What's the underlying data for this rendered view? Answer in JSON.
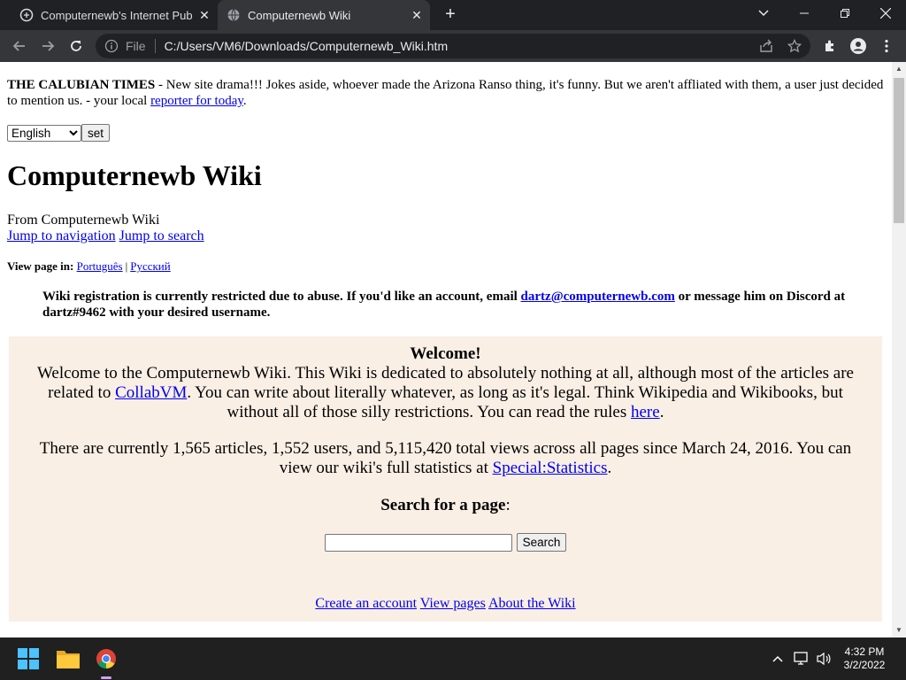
{
  "browser": {
    "tabs": [
      {
        "title": "Computernewb's Internet Pub Hub",
        "active": false
      },
      {
        "title": "Computernewb Wiki",
        "active": true
      }
    ],
    "address": {
      "scheme_label": "File",
      "url": "C:/Users/VM6/Downloads/Computernewb_Wiki.htm"
    }
  },
  "page": {
    "news": {
      "prefix": "THE CALUBIAN TIMES",
      "text": " - New site drama!!! Jokes aside, whoever made the Arizona Ranso thing, it's funny. But we aren't affliated with them, a user just decided to mention us. - your local ",
      "link": "reporter for today",
      "suffix": "."
    },
    "language": {
      "selected": "English",
      "set_label": "set"
    },
    "title": "Computernewb Wiki",
    "from": "From Computernewb Wiki",
    "jump_nav": "Jump to navigation",
    "jump_search": "Jump to search",
    "view_in_label": "View page in:",
    "view_in_langs": [
      "Português",
      "Русский"
    ],
    "notice": {
      "text1": "Wiki registration is currently restricted due to abuse. If you'd like an account, email ",
      "email": "dartz@computernewb.com",
      "text2": " or message him on Discord at dartz#9462 with your desired username."
    },
    "welcome": {
      "title": "Welcome!",
      "p1_a": "Welcome to the Computernewb Wiki. This Wiki is dedicated to absolutely nothing at all, although most of the articles are related to ",
      "p1_link": "CollabVM",
      "p1_b": ". You can write about literally whatever, as long as it's legal. Think Wikipedia and Wikibooks, but without all of those silly restrictions. You can read the rules ",
      "p1_link2": "here",
      "p1_c": ".",
      "p2_a": "There are currently 1,565 articles, 1,552 users, and 5,115,420 total views across all pages since March 24, 2016. You can view our wiki's full statistics at ",
      "p2_link": "Special:Statistics",
      "p2_b": ".",
      "search_title": "Search for a page",
      "search_colon": ":",
      "search_button": "Search",
      "links": [
        "Create an account",
        "View pages",
        "About the Wiki"
      ]
    }
  },
  "taskbar": {
    "time": "4:32 PM",
    "date": "3/2/2022"
  },
  "colors": {
    "welcome_bg": "#faefe5",
    "link": "#0000ee",
    "chrome_dark": "#202124",
    "chrome_toolbar": "#35363a"
  }
}
